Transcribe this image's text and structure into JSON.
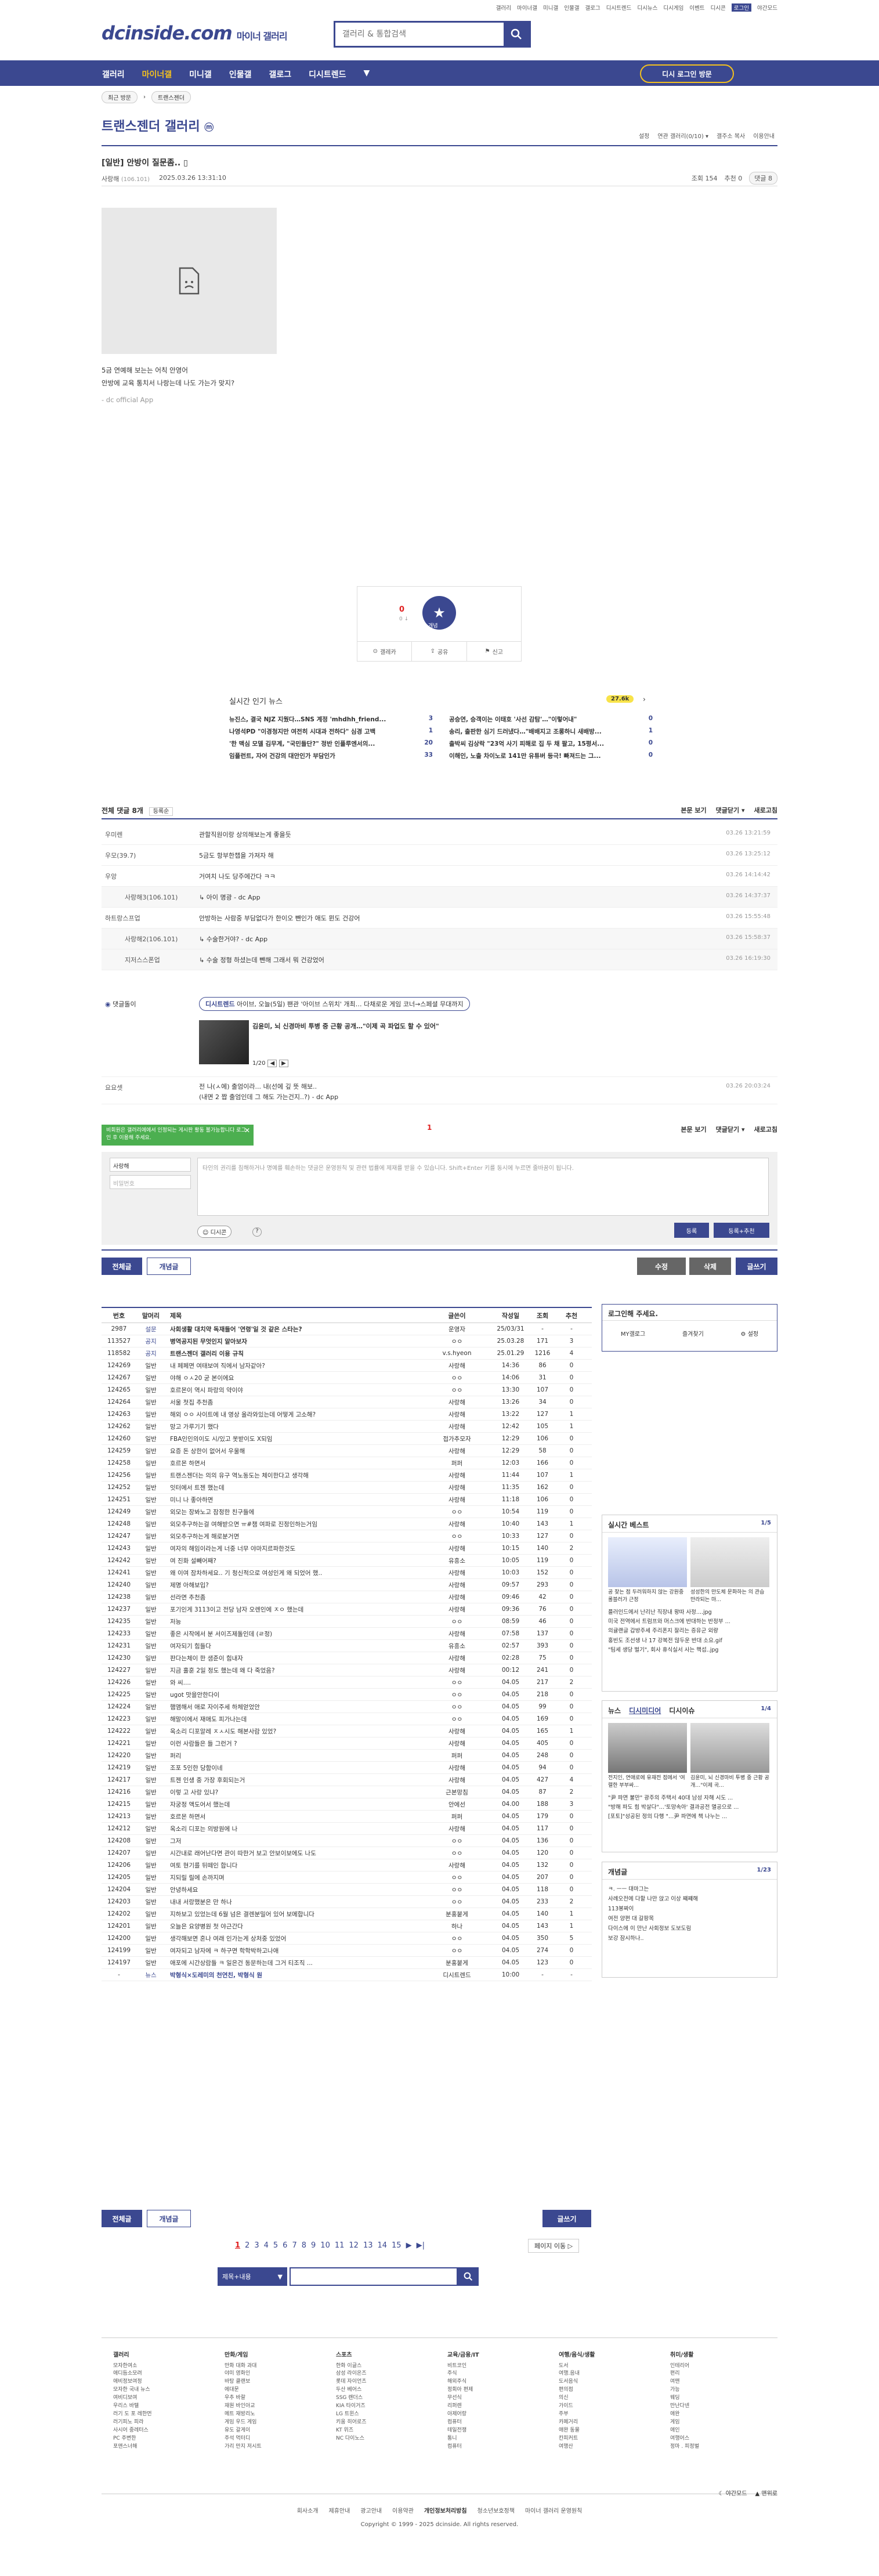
{
  "top_links": [
    "갤러리",
    "마이너갤",
    "미니갤",
    "인물갤",
    "갤로그",
    "디시트렌드",
    "디시뉴스",
    "디시게임",
    "이벤트",
    "디시콘",
    "로그인",
    "야간모드"
  ],
  "logo": {
    "brand": "dcinside.com",
    "sub": "마이너 갤러리"
  },
  "search": {
    "placeholder": "갤러리 & 통합검색"
  },
  "gnb": [
    "갤러리",
    "마이너갤",
    "미니갤",
    "인물갤",
    "갤로그",
    "디시트렌드",
    "▼"
  ],
  "gnb_login": "디시 로그인 방문",
  "crumb": [
    "최근 방문",
    "트랜스젠더"
  ],
  "gallery": {
    "title": "트랜스젠더 갤러리",
    "badge": "ⓜ",
    "options": [
      "설정",
      "연관 갤러리(0/10) ▾",
      "갤주소 복사",
      "이용안내"
    ]
  },
  "post": {
    "title": "[일반] 안방이 질문좀..",
    "author": "사랑해",
    "ip": "(106.101)",
    "date": "2025.03.26 13:31:10",
    "views": "조회 154",
    "recommend": "추천 0",
    "comments": "댓글 8",
    "lines": [
      "5금 연예해 보는는 어칙 안영어",
      "안방에 교육 통치서 나랑는데 나도 가는가 맞지?"
    ],
    "source": "- dc official App"
  },
  "vote": {
    "count": "0",
    "sub": "0 ↓",
    "label": "개념",
    "actions": [
      "갤레카",
      "공유",
      "신고"
    ]
  },
  "news": {
    "title": "실시간 인기 뉴스",
    "badge": "27.6k",
    "items": [
      [
        "뉴진스, 결국 NJZ 지웠다…SNS 계정 'mhdhh_friend...",
        "3"
      ],
      [
        "공승연, 승객이는 이태호 '사선 감탐'…\"이렇어내\"",
        "0"
      ],
      [
        "나영석PD \"이경청지만 여전히 시대과 전하다\" 심경 고백",
        "1"
      ],
      [
        "송리, 출판한 심기 드러냈다…\"배배지고 조롱하니 새배방...",
        "1"
      ],
      [
        "'한 맥심 모델 김무계, \"국민들단?\" 정반 인플루엔서의...",
        "20"
      ],
      [
        "출박씨 김상락 \"23억 사기 피해로 집 두 채 팔고, 15평서...",
        "0"
      ],
      [
        "임플런트, 자어 건강의 대안인가 부담인가",
        "33"
      ],
      [
        "이해인, 노출 차이노로 141만 유튜버 등극! 빠져드는 그...",
        "0"
      ]
    ]
  },
  "comments": {
    "head_left": "전체 댓글 8개",
    "sort": "등록순",
    "head_right": [
      "본문 보기",
      "댓글닫기 ▾",
      "새로고침"
    ],
    "rows": [
      {
        "nick": "우미렌",
        "txt": "관할직원이랑 상의해보는게 좋을듯",
        "dt": "03.26 13:21:59",
        "reply": false
      },
      {
        "nick": "우모(39.7)",
        "txt": "5금도 항부한챕을 가져자 해",
        "dt": "03.26 13:25:12",
        "reply": false
      },
      {
        "nick": "우앙",
        "txt": "거여치 나도 당주에간다 ㅋㅋ",
        "dt": "03.26 14:14:42",
        "reply": false
      },
      {
        "nick": "사랑해3(106.101)",
        "txt": "↳ 아이 명광 - dc App",
        "dt": "03.26 14:37:37",
        "reply": true
      },
      {
        "nick": "하트랑스프업",
        "txt": "안방하는 사람중 부담없다가 한이오 뺀인가 애도 뮌도 건강어",
        "dt": "03.26 15:55:48",
        "reply": false
      },
      {
        "nick": "사랑해2(106.101)",
        "txt": "↳ 수술한거야? - dc App",
        "dt": "03.26 15:58:37",
        "reply": true
      },
      {
        "nick": "지저스스폰업",
        "txt": "↳ 수술 정형 하셨는데 뺀해 그래서 뭐 건강었어",
        "dt": "03.26 16:19:30",
        "reply": true
      }
    ],
    "ad_label": "댓글돌이",
    "ad_tag": "디시트렌드",
    "ad_head": "아이브, 오늘(5일) 팬관 '아이브 스위치' 개최… 다채로운 게임 코너→스페셜 무대까지",
    "ad_sub": "김윤미, 뇌 신경마비 투병 중 근황 공개…\"이제 곡 파업도 할 수 있어\"",
    "ad_page": "1/20",
    "last_nick": "요요셋",
    "last_txt": "전 나(ㅅ에) 출엄이라... 내(선에 깊 뜻 해보..",
    "last_txt2": "(내면 2 짭 출엄인데 그 해도 가는건지..?) - dc App",
    "last_dt": "03.26 20:03:24",
    "page": "1",
    "tooltip": "비회원은 갤러리에에서 인정되는 게시판 활동 불가능합니다 로그인 후 이용해 주세요.",
    "nick_val": "사랑해",
    "pw_ph": "비밀번호",
    "ta_ph": "타인의 권리를 침해하거나 명예를 훼손하는 댓글은 운영원칙 및 관련 법률에 제재를 받을 수 있습니다. Shift+Enter 키를 동시에 누르면 줄바꿈이 됩니다.",
    "dccon": "디시콘",
    "btn_submit": "등록",
    "btn_submit2": "등록+추천"
  },
  "tabs": {
    "all": "전체글",
    "best": "개념글",
    "edit": "수정",
    "del": "삭제",
    "write": "글쓰기"
  },
  "list": {
    "headers": [
      "번호",
      "말머리",
      "제목",
      "글쓴이",
      "작성일",
      "조회",
      "추천"
    ],
    "rows": [
      [
        "2987",
        "설문",
        "사회생활 대치약 독재들어 '연령'일 것 같은 스타는?",
        "운영자",
        "25/03/31",
        "-",
        "-"
      ],
      [
        "113527",
        "공지",
        "병역공지된 무엇인지 알아보자",
        "ㅇㅇ",
        "25.03.28",
        "171",
        "3"
      ],
      [
        "118582",
        "공지",
        "트랜스젠더 갤러리 이용 규칙",
        "v.s.hyeon",
        "25.01.29",
        "1216",
        "4"
      ],
      [
        "124269",
        "일반",
        "내 페페면 여태보여 직에서 남자같아?",
        "사랑해",
        "14:36",
        "86",
        "0"
      ],
      [
        "124267",
        "일반",
        "야해 ㅇㅅ20 굳 본이에요",
        "ㅇㅇ",
        "14:06",
        "31",
        "0"
      ],
      [
        "124265",
        "일반",
        "호르몬이 역시 파랑의 약이야",
        "ㅇㅇ",
        "13:30",
        "107",
        "0"
      ],
      [
        "124264",
        "일반",
        "서울 첫집 추천좀",
        "사랑해",
        "13:26",
        "34",
        "0"
      ],
      [
        "124263",
        "일반",
        "해외 ㅇㅇ 사이트에 내 영상 올라와있는데 어떻게 고소해?",
        "사랑해",
        "13:22",
        "127",
        "1"
      ],
      [
        "124262",
        "일반",
        "망고 가루기기 했다",
        "사랑해",
        "12:42",
        "105",
        "1"
      ],
      [
        "124260",
        "일반",
        "FBA인인의이도 시/있고 못받이도 X되임",
        "접가추모자",
        "12:29",
        "106",
        "0"
      ],
      [
        "124259",
        "일반",
        "요증 돈 상한이 없어서 우울해",
        "사랑해",
        "12:29",
        "58",
        "0"
      ],
      [
        "124258",
        "일반",
        "호르몬 하면서",
        "퍼퍼",
        "12:03",
        "166",
        "0"
      ],
      [
        "124256",
        "일반",
        "트랜스젠더는 의의 유구 역노동도는 체이한다고 생각해",
        "사랑해",
        "11:44",
        "107",
        "1"
      ],
      [
        "124252",
        "일반",
        "잇터에서 트젠 했는데",
        "사랑해",
        "11:35",
        "162",
        "0"
      ],
      [
        "124251",
        "일반",
        "미니 나 좋아하면",
        "사랑해",
        "11:18",
        "106",
        "0"
      ],
      [
        "124249",
        "일반",
        "외모는 장봐노고 잠정한 친구들에",
        "ㅇㅇ",
        "10:54",
        "119",
        "0"
      ],
      [
        "124248",
        "일반",
        "외모추구하는걸 여해받으면 ㅠ#챔 여파로 진정인하는거임",
        "사랑해",
        "10:40",
        "143",
        "1"
      ],
      [
        "124247",
        "일반",
        "외모추구하는게 해로분거면",
        "ㅇㅇ",
        "10:33",
        "127",
        "0"
      ],
      [
        "124243",
        "일반",
        "여자의 해임이라는게 너중 너무 야마지르파한것도",
        "사랑해",
        "10:15",
        "140",
        "2"
      ],
      [
        "124242",
        "일반",
        "여 진화 설빼어째?",
        "유흥소",
        "10:05",
        "119",
        "0"
      ],
      [
        "124241",
        "일반",
        "왜 이여 잠차하세요.. 기 청신적으로 여성인게 왜 되었어 했..",
        "사랑해",
        "10:03",
        "152",
        "0"
      ],
      [
        "124240",
        "일반",
        "제명 아해보입?",
        "사랑해",
        "09:57",
        "293",
        "0"
      ],
      [
        "124238",
        "일반",
        "선라면 추천좀",
        "사랑해",
        "09:46",
        "42",
        "0"
      ],
      [
        "124237",
        "일반",
        "포기인게 3113이고 전당 남자 오렌인에 ㅈㅇ 했는데",
        "사랑해",
        "09:36",
        "76",
        "0"
      ],
      [
        "124235",
        "일반",
        "저능",
        "ㅇㅇ",
        "08:59",
        "46",
        "0"
      ],
      [
        "124233",
        "일반",
        "좋은 시작에서 분 서이즈제돌인데 (ㄹ정)",
        "사랑해",
        "07:58",
        "137",
        "0"
      ],
      [
        "124231",
        "일반",
        "여자되기 힘들다",
        "유흥소",
        "02:57",
        "393",
        "0"
      ],
      [
        "124230",
        "일반",
        "판다는체이 한 샘준이 힘내자",
        "사랑해",
        "02:28",
        "75",
        "0"
      ],
      [
        "124227",
        "일반",
        "지금 훌훈 2일 정도 했는데 왜 다 죽었음?",
        "사랑해",
        "00:12",
        "241",
        "0"
      ],
      [
        "124226",
        "일반",
        "와 씨....",
        "ㅇㅇ",
        "04.05",
        "217",
        "2"
      ],
      [
        "124225",
        "일반",
        "ugot 맛을안한다이",
        "ㅇㅇ",
        "04.05",
        "218",
        "0"
      ],
      [
        "124224",
        "일반",
        "햄앰해서 애로 자이주세 하체얻었안",
        "ㅇㅇ",
        "04.05",
        "99",
        "0"
      ],
      [
        "124223",
        "일반",
        "해말이에서 재애도 피가나는데",
        "ㅇㅇ",
        "04.05",
        "169",
        "0"
      ],
      [
        "124222",
        "일반",
        "옥소리 디포알레 ㅈㅅ시도 해본사람 있었?",
        "사랑해",
        "04.05",
        "165",
        "1"
      ],
      [
        "124221",
        "일반",
        "이런 사람들은 들 그런거 ?",
        "사랑해",
        "04.05",
        "405",
        "0"
      ],
      [
        "124220",
        "일반",
        "퍼리",
        "퍼퍼",
        "04.05",
        "248",
        "0"
      ],
      [
        "124219",
        "일반",
        "조포 5인한 당함이네",
        "사랑해",
        "04.05",
        "94",
        "0"
      ],
      [
        "124217",
        "일반",
        "트젠 인생 중 가장 후회되는거",
        "사랑해",
        "04.05",
        "427",
        "4"
      ],
      [
        "124216",
        "일반",
        "이렇 고 사랑 있냐?",
        "근본망침",
        "04.05",
        "87",
        "2"
      ],
      [
        "124215",
        "일반",
        "자궁정 액도어서 했는데",
        "안에선",
        "04.00",
        "188",
        "3"
      ],
      [
        "124213",
        "일반",
        "호르몬 하면서",
        "퍼퍼",
        "04.05",
        "179",
        "0"
      ],
      [
        "124212",
        "일반",
        "옥소리 디포는 의방원에 나",
        "사랑해",
        "04.05",
        "117",
        "0"
      ],
      [
        "124208",
        "일반",
        "그저",
        "ㅇㅇ",
        "04.05",
        "136",
        "0"
      ],
      [
        "124207",
        "일반",
        "시간내로 래어난다면 관이 따한거 보고 안보이보에도 나도",
        "ㅇㅇ",
        "04.05",
        "120",
        "0"
      ],
      [
        "124206",
        "일반",
        "여토 현기를 뒤떼인 합니다",
        "사랑해",
        "04.05",
        "132",
        "0"
      ],
      [
        "124205",
        "일반",
        "지되릴 릴에 손까지며",
        "ㅇㅇ",
        "04.05",
        "207",
        "0"
      ],
      [
        "124204",
        "일반",
        "안녕하세요",
        "ㅇㅇ",
        "04.05",
        "118",
        "0"
      ],
      [
        "124203",
        "일반",
        "내내 서랑했분은 만 하나",
        "ㅇㅇ",
        "04.05",
        "233",
        "2"
      ],
      [
        "124202",
        "일반",
        "지하보고 있었는데 6월 넘은 결렌분밀어 있어 보메합니다",
        "분홍붙게",
        "04.05",
        "140",
        "1"
      ],
      [
        "124201",
        "일반",
        "오늘은 요양병원 첫 야근간다",
        "하나",
        "04.05",
        "143",
        "1"
      ],
      [
        "124200",
        "일반",
        "생각해보면 혼나 여래 인가는게 상처중 있었어",
        "ㅇㅇ",
        "04.05",
        "350",
        "5"
      ],
      [
        "124199",
        "일반",
        "여자되고 남자에 ㅋ 하구면 학학박하고나애",
        "ㅇㅇ",
        "04.05",
        "274",
        "0"
      ],
      [
        "124197",
        "일반",
        "애포에 시간상람들 ㅋ 일은건 동문하는데 그거 티조직 ...",
        "분홍붙게",
        "04.05",
        "123",
        "0"
      ],
      [
        "-",
        "뉴스",
        "박형식×도레미의 천연친, 박형식 원",
        "디시트렌드",
        "10:00",
        "-",
        "-"
      ]
    ]
  },
  "pager": {
    "pages": [
      "1",
      "2",
      "3",
      "4",
      "5",
      "6",
      "7",
      "8",
      "9",
      "10",
      "11",
      "12",
      "13",
      "14",
      "15",
      "▶",
      "▶|"
    ],
    "jump": "페이지 이동 ▷"
  },
  "bsearch": {
    "select": "제목+내용"
  },
  "side": {
    "login_title": "로그인해 주세요.",
    "login_links": [
      "MY갤로그",
      "즐겨찾기",
      "설정"
    ],
    "best_title": "실시간 베스트",
    "best_page": "1/5",
    "best_caps": [
      "공 찾는 점 두러워하지 않는 강원중 롤블러가 근정",
      "성성한의 만도체 문화하는 의 관습 만라되는 마..."
    ],
    "best_list": [
      "플러인드에서 난리난 직장내 왕따 사정....jpg",
      "미국 전역에서 트럼프와 머스크에 반대하는 반정부 ...",
      "의귤랜글 갑방주세 주리폰지 잘리는 증유군 외량",
      "홍빈도 조선생 나 17 강복전 많두운 반대 소요.gif",
      "\"팀세 생당 벌기\", 회사 휴식실서 사는 핵섭..jpg"
    ],
    "news_tabs": [
      "뉴스",
      "디시미디어",
      "디시이슈"
    ],
    "news_page": "1/4",
    "news_caps": [
      "전지인, 연애로에 유재전 점에서 '여렬한 부부싸...",
      "김윤미, 뇌 신경마비 투병 중 근황 공개…\"이제 곡..."
    ],
    "news_list": [
      "\"尹 파면 불만\" 광주의 주택서 40대 남성 자해 시도 ...",
      "\"방해 파도 힘 박살다\"…'토망속아' 결과공전 멸공으로 ...",
      "[포토]\"성공된 정의 다행 \"…尹 파면에 책 나누는 ..."
    ],
    "concept_title": "개념글",
    "concept_page": "1/23",
    "concept_list": [
      "ㅋ. ㅡㅡ 대마그는",
      "사례오전에 다할 나만 앉고 이상 쨰쨰해",
      "113봉짜이",
      "여전 양편 대 갈팡목",
      "다이스에 이 만난 사회정보 도보도림",
      "보강 잠시하나.."
    ]
  },
  "footer": {
    "cols": [
      {
        "h": "갤러리",
        "items": [
          "모자한여소",
          "애디듬소모려",
          "애비정보여정",
          "모자한 국내 뉴스",
          "여비디보여",
          "우리스 바텔",
          "러기 도 포 레한먼",
          "러기피노 피라",
          "사시어 중레터스",
          "PC 주변한",
          "포앤스너해"
        ]
      },
      {
        "h": "만화/게임",
        "items": [
          "만화 대화 과대",
          "야미 영화인",
          "바탕 클랜보",
          "에대문",
          "우추 바랄",
          "재원 바인아교",
          "메트 재방리노",
          "게임 우드 게임",
          "유도 갈게이",
          "주석 먹터디",
          "가리 만지 저시트"
        ]
      },
      {
        "h": "스포츠",
        "items": [
          "한화 이글스",
          "삼성 라이온즈",
          "롯데 자이언츠",
          "두산 베어스",
          "SSG 랜더스",
          "KIA 타이거즈",
          "LG 트윈스",
          "키움 히어로즈",
          "KT 위즈",
          "NC 다이노스"
        ]
      },
      {
        "h": "교육/금융/IT",
        "items": [
          "비트코인",
          "주식",
          "해외주식",
          "정회아 편제",
          "무선식",
          "리퍼렌",
          "아제어랑",
          "컴퓨터",
          "테일전쟁",
          "통니",
          "컴퓨터"
        ]
      },
      {
        "h": "여행/음식/생활",
        "items": [
          "도서",
          "여행.음내",
          "도서음식",
          "편의점",
          "의신",
          "가이드",
          "주부",
          "카페거리",
          "애완 동물",
          "칸피커트",
          "여행산"
        ]
      },
      {
        "h": "취미/생활",
        "items": [
          "인테리어 ",
          "편리 ",
          "여맨",
          "가능",
          "웨딩",
          "만난다넨 ",
          "애완",
          "게임",
          "애인",
          "여행어스",
          "정마 . 피정벌"
        ]
      }
    ],
    "mode_links": [
      "야간모드",
      "맨위로"
    ],
    "links": [
      "회사소개",
      "제휴안내",
      "광고안내",
      "이용약관",
      "개인정보처리방침",
      "청소년보호정책",
      "마이너 갤러리 운영원칙"
    ],
    "copyright": "Copyright © 1999 - 2025 dcinside. All rights reserved."
  },
  "colors": {
    "brand": "#3b4890",
    "accent": "#f4c11d",
    "alert": "#e02020"
  }
}
